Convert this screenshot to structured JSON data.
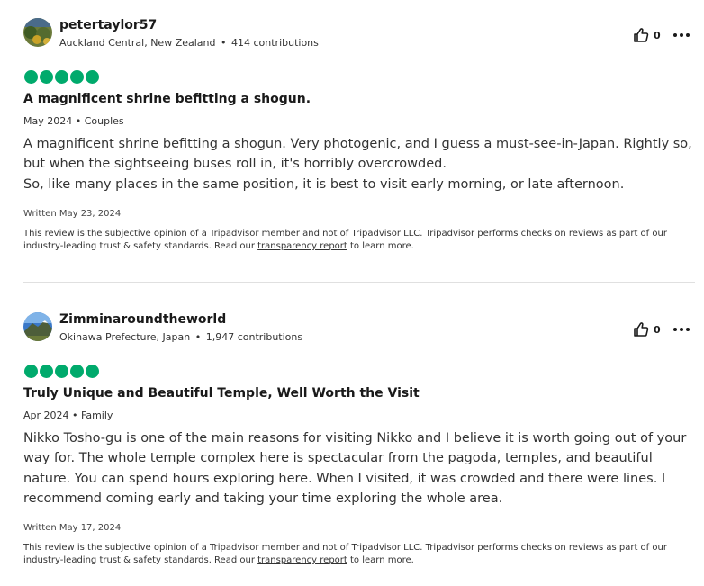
{
  "colors": {
    "rating_green": "#00aa6c",
    "text": "#1a1a1a",
    "divider": "#e0e0e0"
  },
  "reviews": [
    {
      "username": "petertaylor57",
      "location": "Auckland Central, New Zealand",
      "contributions": "414 contributions",
      "helpful_count": "0",
      "rating": 5,
      "title": "A magnificent shrine befitting a shogun.",
      "date": "May 2024",
      "trip_type": "Couples",
      "body": [
        "A magnificent shrine befitting a shogun. Very photogenic, and I guess a must-see-in-Japan. Rightly so, but when the sightseeing buses roll in, it's horribly overcrowded.",
        "So, like many places in the same position, it is best to visit early morning, or late afternoon."
      ],
      "written": "Written May 23, 2024",
      "disclaimer_pre": "This review is the subjective opinion of a Tripadvisor member and not of Tripadvisor LLC. Tripadvisor performs checks on reviews as part of our industry-leading trust & safety standards. Read our ",
      "disclaimer_link": "transparency report",
      "disclaimer_post": " to learn more."
    },
    {
      "username": "Zimminaroundtheworld",
      "location": "Okinawa Prefecture, Japan",
      "contributions": "1,947 contributions",
      "helpful_count": "0",
      "rating": 5,
      "title": "Truly Unique and Beautiful Temple, Well Worth the Visit",
      "date": "Apr 2024",
      "trip_type": "Family",
      "body": [
        "Nikko Tosho-gu is one of the main reasons for visiting Nikko and I believe it is worth going out of your way for. The whole temple complex here is spectacular from the pagoda, temples, and beautiful nature. You can spend hours exploring here. When I visited, it was crowded and there were lines. I recommend coming early and taking your time exploring the whole area."
      ],
      "written": "Written May 17, 2024",
      "disclaimer_pre": "This review is the subjective opinion of a Tripadvisor member and not of Tripadvisor LLC. Tripadvisor performs checks on reviews as part of our industry-leading trust & safety standards. Read our ",
      "disclaimer_link": "transparency report",
      "disclaimer_post": " to learn more."
    }
  ],
  "separator": "•"
}
